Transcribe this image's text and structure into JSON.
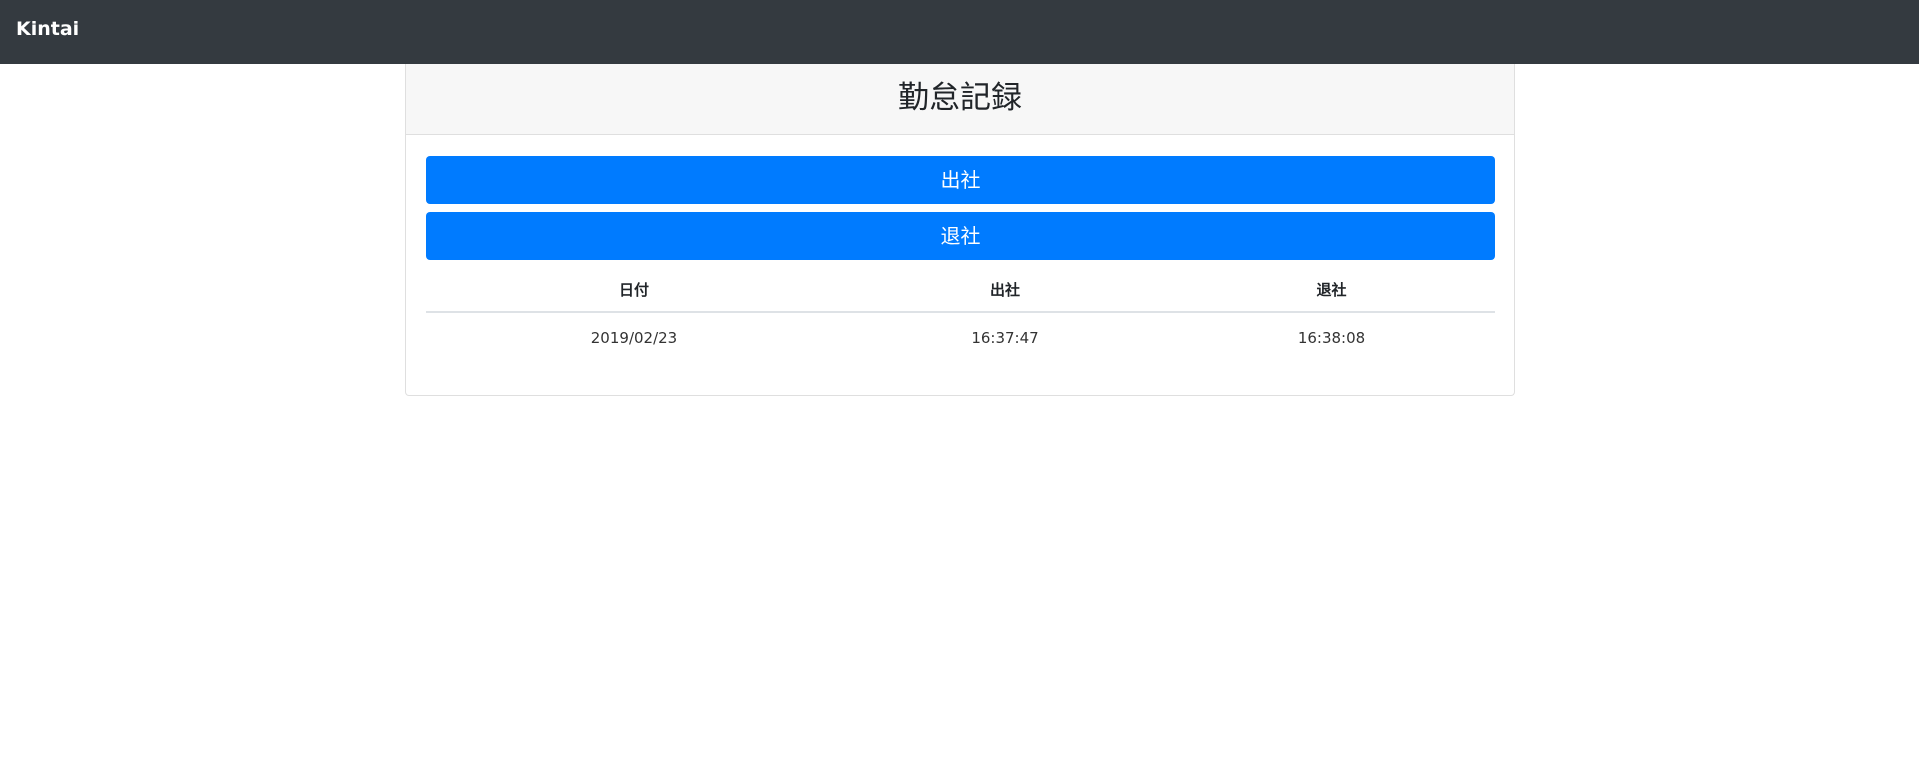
{
  "navbar": {
    "brand": "Kintai"
  },
  "card": {
    "title": "勤怠記録",
    "clock_in_label": "出社",
    "clock_out_label": "退社"
  },
  "table": {
    "headers": [
      "日付",
      "出社",
      "退社"
    ],
    "rows": [
      [
        "2019/02/23",
        "16:37:47",
        "16:38:08"
      ]
    ]
  },
  "colors": {
    "navbar_bg": "#343a40",
    "primary": "#007bff",
    "card_header_bg": "#f7f7f7"
  }
}
